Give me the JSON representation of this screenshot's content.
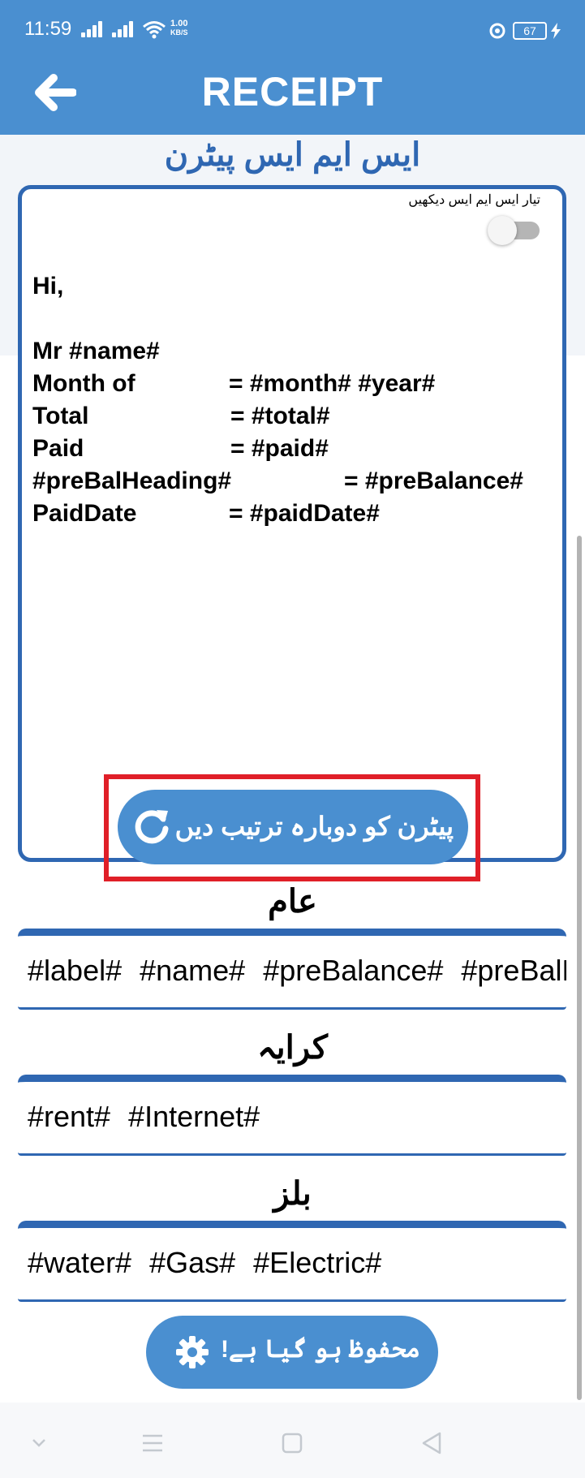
{
  "status_bar": {
    "time": "11:59",
    "net_speed_value": "1.00",
    "net_speed_unit": "KB/S",
    "battery": "67"
  },
  "header": {
    "title": "RECEIPT",
    "back_icon": "arrow-left-icon"
  },
  "sms_section": {
    "heading": "ایس ایم ایس پیٹرن",
    "toggle_label": "تیار ایس ایم ایس دیکھیں",
    "toggle_on": false,
    "template": {
      "greeting": "Hi,",
      "name_line": "Mr #name#",
      "rows": [
        {
          "label": "Month of",
          "value": "= #month# #year#"
        },
        {
          "label": "Total",
          "value": "= #total#"
        },
        {
          "label": "Paid",
          "value": "= #paid#"
        },
        {
          "label": "#preBalHeading#",
          "value": "= #preBalance#"
        },
        {
          "label": "PaidDate",
          "value": "= #paidDate#"
        }
      ]
    },
    "reset_button": {
      "label": "پیٹرن کو دوبارہ ترتیب دیں",
      "icon": "refresh-icon"
    }
  },
  "tag_groups": [
    {
      "heading": "عام",
      "tags": [
        "#label#",
        "#name#",
        "#preBalance#",
        "#preBalHeading#"
      ]
    },
    {
      "heading": "کرایہ",
      "tags": [
        "#rent#",
        "#Internet#"
      ]
    },
    {
      "heading": "بلز",
      "tags": [
        "#water#",
        "#Gas#",
        "#Electric#"
      ]
    }
  ],
  "save_button": {
    "label": "محفوظ ہو گیا ہے!",
    "icon": "gear-icon"
  },
  "nav_bar": {
    "icons": [
      "chevron-down-icon",
      "menu-icon",
      "home-square-icon",
      "back-triangle-icon"
    ]
  },
  "colors": {
    "accent": "#4a8fd0",
    "border": "#2f67b2",
    "highlight": "#e01f28"
  }
}
